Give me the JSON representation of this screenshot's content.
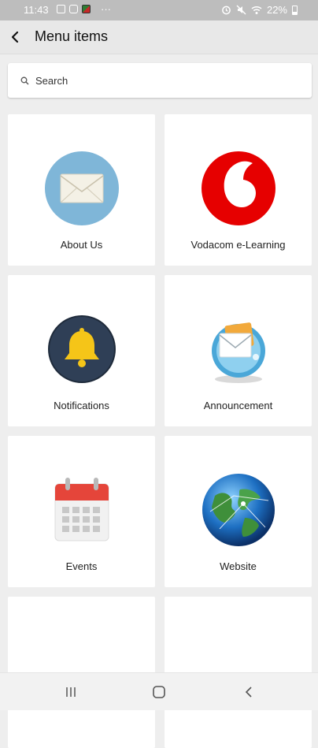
{
  "status_bar": {
    "time": "11:43",
    "battery": "22%",
    "more": "···"
  },
  "header": {
    "title": "Menu items"
  },
  "search": {
    "placeholder": "Search"
  },
  "menu_items": [
    {
      "label": "About Us",
      "icon": "envelope-icon"
    },
    {
      "label": "Vodacom e-Learning",
      "icon": "vodacom-logo-icon"
    },
    {
      "label": "Notifications",
      "icon": "bell-icon"
    },
    {
      "label": "Announcement",
      "icon": "mail-icon"
    },
    {
      "label": "Events",
      "icon": "calendar-icon"
    },
    {
      "label": "Website",
      "icon": "globe-icon"
    },
    {
      "label": "",
      "icon": "video-camera-icon"
    },
    {
      "label": "",
      "icon": "monitor-icon"
    }
  ],
  "colors": {
    "accent_red": "#e60000",
    "bell_bg": "#2f3f56",
    "bell": "#f5c518",
    "envelope_bg": "#7fb6d8",
    "calendar_red": "#e5453a"
  }
}
